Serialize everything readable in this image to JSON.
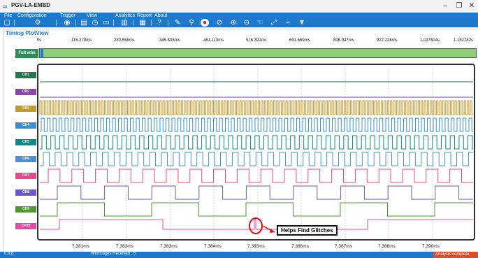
{
  "window": {
    "title": "PGV-LA-EMBD",
    "controls": [
      "–",
      "❐",
      "✕"
    ]
  },
  "menu": [
    {
      "label": "File"
    },
    {
      "label": "Configuration"
    },
    {
      "label": "Trigger"
    },
    {
      "label": "View"
    },
    {
      "label": "Analytics"
    },
    {
      "label": "Report"
    },
    {
      "label": "About"
    }
  ],
  "toolbar_icons": [
    "new-file-icon",
    "config-icon",
    "trigger-icon",
    "view-save-icon",
    "view-clock-icon",
    "view-display-icon",
    "analytics-chart-icon",
    "report-icon",
    "help-icon",
    "probe-icon",
    "marker-icon",
    "stop-icon",
    "timing-icon",
    "zoom-in-icon",
    "zoom-out-icon",
    "pan-icon",
    "fit-icon",
    "wave-icon",
    "filter-icon"
  ],
  "panel": {
    "title": "Timing PlotView"
  },
  "ruler": [
    "0s",
    "115.278ms",
    "230.556ms",
    "345.835ms",
    "461.113ms",
    "576.391ms",
    "691.669ms",
    "806.947ms",
    "922.226ms",
    "1.037504s",
    "1.152782s"
  ],
  "full_waveform": {
    "label": "Full wfm"
  },
  "channels": [
    {
      "label": "CH1",
      "color": "#1e7a4a",
      "kind": "flat-high"
    },
    {
      "label": "CH2",
      "color": "#8e44ad",
      "kind": "flat-low"
    },
    {
      "label": "CH3",
      "color": "#c59a2d",
      "kind": "dense"
    },
    {
      "label": "CH4",
      "color": "#3a8fd1",
      "kind": "fast"
    },
    {
      "label": "CH5",
      "color": "#0f8a8a",
      "kind": "fast2"
    },
    {
      "label": "CH6",
      "color": "#4a90d9",
      "kind": "medium"
    },
    {
      "label": "CH7",
      "color": "#e8478b",
      "kind": "slow"
    },
    {
      "label": "CH8",
      "color": "#6a5acd",
      "kind": "slower"
    },
    {
      "label": "CH9",
      "color": "#4e9a2e",
      "kind": "slowest"
    },
    {
      "label": "CH10",
      "color": "#d94fa6",
      "kind": "glitch"
    }
  ],
  "time_axis": [
    "7.381ms",
    "7.382ms",
    "7.383ms",
    "7.384ms",
    "7.385ms",
    "7.386ms",
    "7.387ms",
    "7.388ms",
    "7.390ms"
  ],
  "annotation": {
    "text": "Helps Find Glitches"
  },
  "status": {
    "left": "0.8.8",
    "middle": "WfmEdges Received : 6",
    "right": "Analysis complete"
  }
}
